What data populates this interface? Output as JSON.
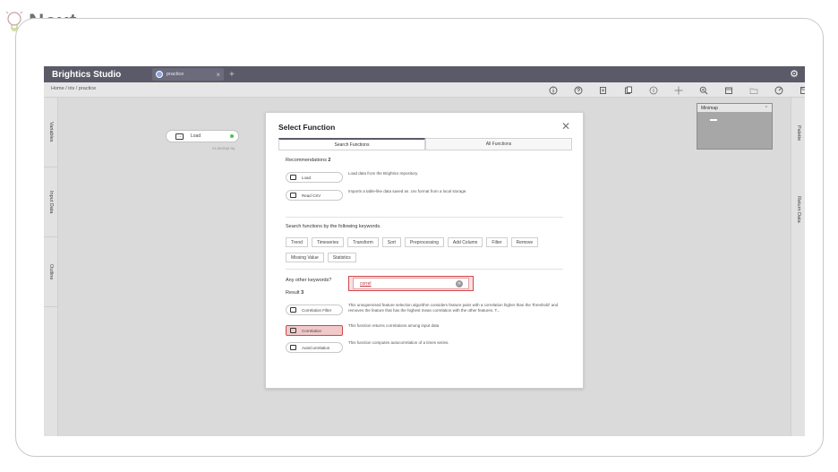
{
  "brand": {
    "text": "Next"
  },
  "app": {
    "title": "Brightics Studio",
    "tab_label": "practice",
    "tab_close": "×",
    "tab_add": "+",
    "settings_icon": "gear-icon",
    "breadcrumb": "Home  /  iris  /  practice"
  },
  "leftbar": {
    "variables": "Variables",
    "input_data": "Input Data",
    "outline": "Outline"
  },
  "rightbar": {
    "palette": "Palette",
    "return_data": "Return Data"
  },
  "canvas": {
    "node_label": "Load",
    "node_time": "21:39:00(3 %)"
  },
  "minimap": {
    "title": "Minimap",
    "chevron": "⌃"
  },
  "dialog": {
    "title": "Select Function",
    "close": "✕",
    "tabs": [
      "Search Functions",
      "All Functions"
    ],
    "recommendations_label": "Recommendations",
    "recommendations_count": "2",
    "recommendations": [
      {
        "name": "Load",
        "desc": "Load data from the Brightics repository."
      },
      {
        "name": "Read CSV",
        "desc": "Imports a table-like data saved as .csv format from a local storage."
      }
    ],
    "keywords_label": "Search functions by the following keywords.",
    "keywords_row1": [
      "Trend",
      "Timeseries",
      "Transform",
      "Sort",
      "Preprocessing",
      "Add Column",
      "Filter",
      "Remove"
    ],
    "keywords_row2": [
      "Missing Value",
      "Statistics"
    ],
    "other_label": "Any other keywords?",
    "search_value": "correl",
    "result_label": "Result",
    "result_count": "3",
    "results": [
      {
        "name": "Correlation Filter",
        "desc": "This unsupervised feature selection algorithm considers feature pairs with a correlation higher than the 'threshold' and removes the feature that has the highest mean correlation with the other features. T..."
      },
      {
        "name": "Correlation",
        "desc": "This function returns correlations among input data"
      },
      {
        "name": "AutoCorrelation",
        "desc": "This function computes autocorrelation of a times series."
      }
    ]
  }
}
